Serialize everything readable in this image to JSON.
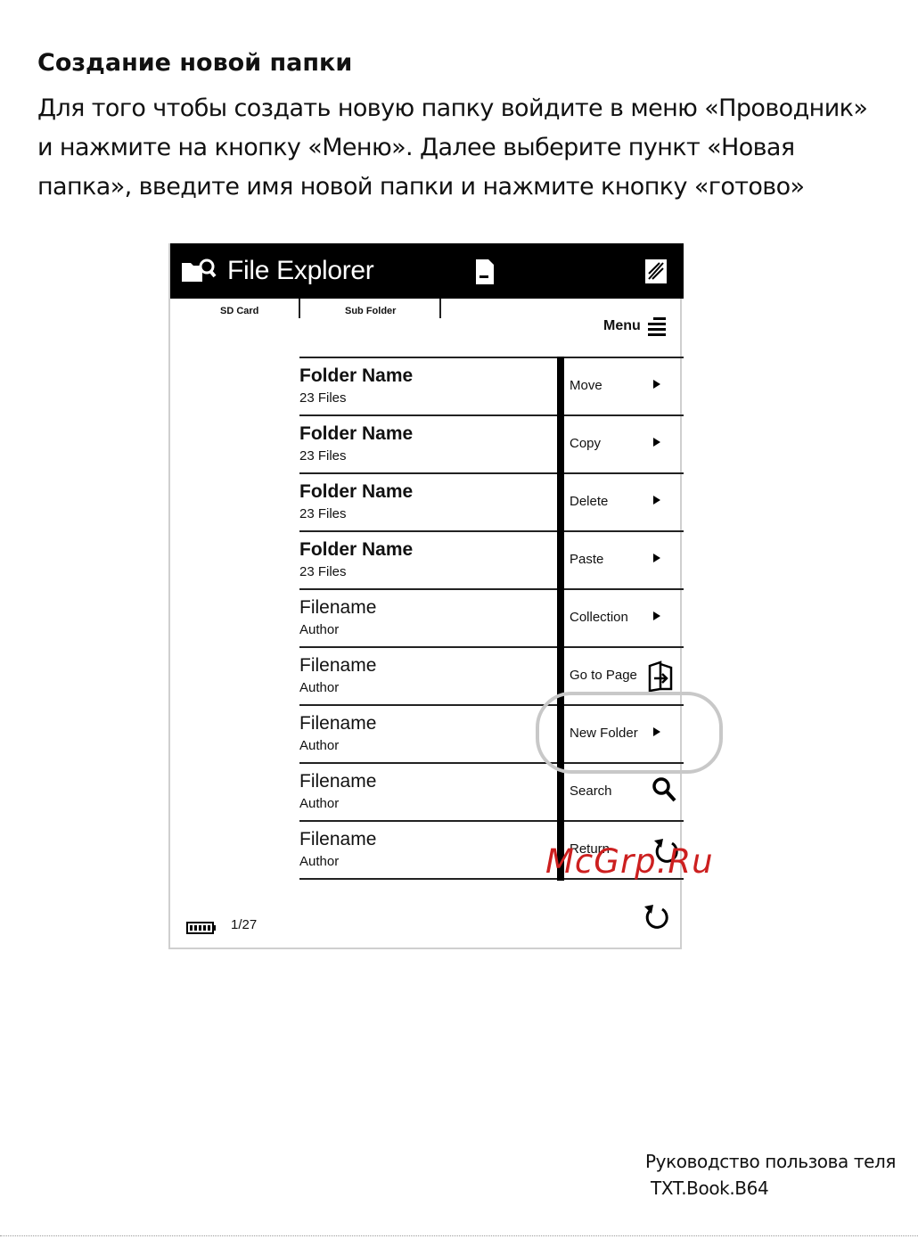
{
  "document": {
    "heading": "Создание новой папки",
    "paragraph_lines": [
      "Для того чтобы создать новую папку войдите в меню «Проводник»",
      "и нажмите на кнопку «Меню». Далее выберите пункт «Новая",
      "папка», введите имя новой папки и нажмите кнопку «готово»"
    ]
  },
  "screenshot": {
    "title": "File Explorer",
    "tabs": [
      "SD Card",
      "Sub Folder"
    ],
    "menu_label": "Menu",
    "list": [
      {
        "name": "Folder Name",
        "sub": "23 Files",
        "bold": true
      },
      {
        "name": "Folder Name",
        "sub": "23 Files",
        "bold": true
      },
      {
        "name": "Folder Name",
        "sub": "23 Files",
        "bold": true
      },
      {
        "name": "Folder Name",
        "sub": "23 Files",
        "bold": true
      },
      {
        "name": "Filename",
        "sub": "Author",
        "bold": false
      },
      {
        "name": "Filename",
        "sub": "Author",
        "bold": false
      },
      {
        "name": "Filename",
        "sub": "Author",
        "bold": false
      },
      {
        "name": "Filename",
        "sub": "Author",
        "bold": false
      },
      {
        "name": "Filename",
        "sub": "Author",
        "bold": false
      }
    ],
    "menu_items": [
      {
        "label": "Move",
        "icon": "arrow-right-icon"
      },
      {
        "label": "Copy",
        "icon": "arrow-right-icon"
      },
      {
        "label": "Delete",
        "icon": "arrow-right-icon"
      },
      {
        "label": "Paste",
        "icon": "arrow-right-icon"
      },
      {
        "label": "Collection",
        "icon": "arrow-right-icon"
      },
      {
        "label": "Go to Page",
        "icon": "go-to-page-icon"
      },
      {
        "label": "New Folder",
        "icon": "arrow-right-icon"
      },
      {
        "label": "Search",
        "icon": "search-icon"
      },
      {
        "label": "Return",
        "icon": "return-icon"
      }
    ],
    "page_indicator": "1/27",
    "highlight_color": "#c8c8c8"
  },
  "watermark": "McGrp.Ru",
  "footer": {
    "line1": "Руководство пользова теля",
    "line2": "TXT.Book.B64"
  }
}
